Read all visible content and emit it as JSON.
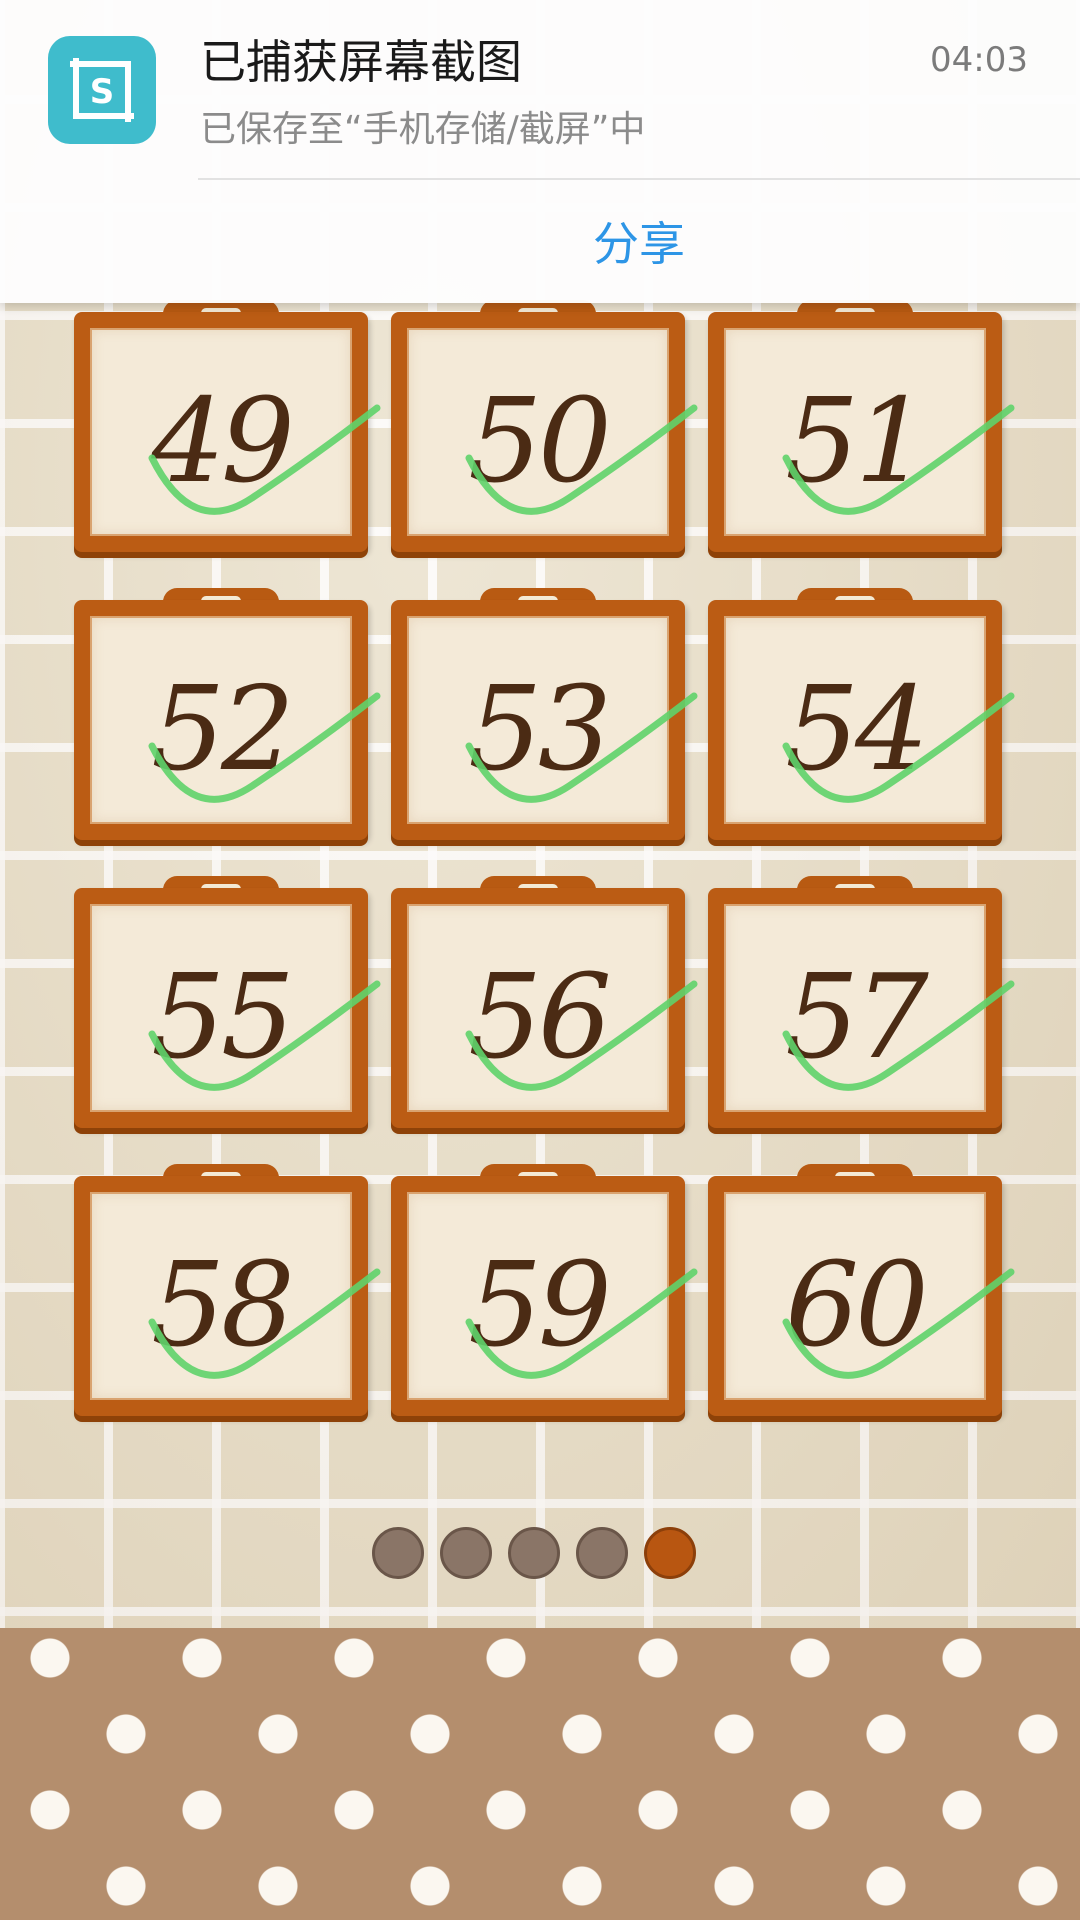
{
  "notification": {
    "title": "已捕获屏幕截图",
    "subtitle": "已保存至“手机存储/截屏”中",
    "time": "04:03",
    "share_label": "分享",
    "app_icon_letter": "S",
    "app_icon": "screenshot-app-icon",
    "accent_color": "#3fbccc"
  },
  "levels": {
    "items": [
      {
        "number": "49",
        "completed": true
      },
      {
        "number": "50",
        "completed": true
      },
      {
        "number": "51",
        "completed": true
      },
      {
        "number": "52",
        "completed": true
      },
      {
        "number": "53",
        "completed": true
      },
      {
        "number": "54",
        "completed": true
      },
      {
        "number": "55",
        "completed": true
      },
      {
        "number": "56",
        "completed": true
      },
      {
        "number": "57",
        "completed": true
      },
      {
        "number": "58",
        "completed": true
      },
      {
        "number": "59",
        "completed": true
      },
      {
        "number": "60",
        "completed": true
      }
    ],
    "check_icon": "checkmark-icon",
    "check_color": "#5fd36a"
  },
  "pager": {
    "total_pages": 5,
    "current_page": 5,
    "active_color": "#b85611",
    "inactive_color": "#8a7567"
  }
}
